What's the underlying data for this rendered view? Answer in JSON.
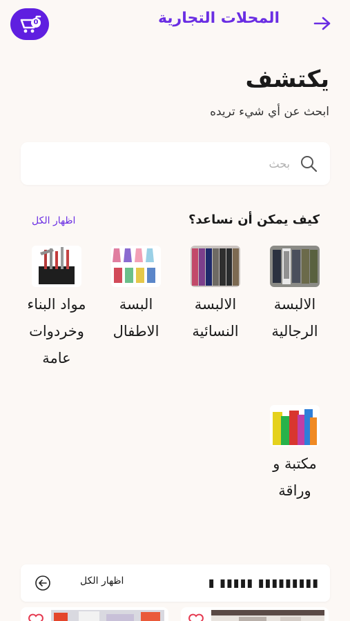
{
  "header": {
    "title": "المحلات التجارية",
    "cart_count": "0"
  },
  "discover": {
    "title": "يكتشف",
    "subtitle": "ابحث عن أي شيء تريده"
  },
  "search": {
    "placeholder": "بحث",
    "value": ""
  },
  "help": {
    "title": "كيف يمكن أن نساعد؟",
    "show_all": "اظهار الكل"
  },
  "categories": [
    {
      "label": "الالبسة الرجالية",
      "icon": "mens-clothing-image"
    },
    {
      "label": "الالبسة النسائية",
      "icon": "womens-clothing-image"
    },
    {
      "label": "البسة الاطفال",
      "icon": "kids-clothing-image"
    },
    {
      "label": "مواد البناء وخردوات عامة",
      "icon": "building-tools-image"
    },
    {
      "label": "مكتبة و وراقة",
      "icon": "stationery-image"
    }
  ],
  "bottom_section": {
    "title": "▮▮▮▮▮▮▮▮▮ ▮▮▮▮▮ ▮",
    "show_all": "اظهار الكل"
  },
  "colors": {
    "accent": "#6a2ee3",
    "cart_bg": "#5f1fe0",
    "background": "#fcf8f5",
    "heart": "#e53950"
  }
}
